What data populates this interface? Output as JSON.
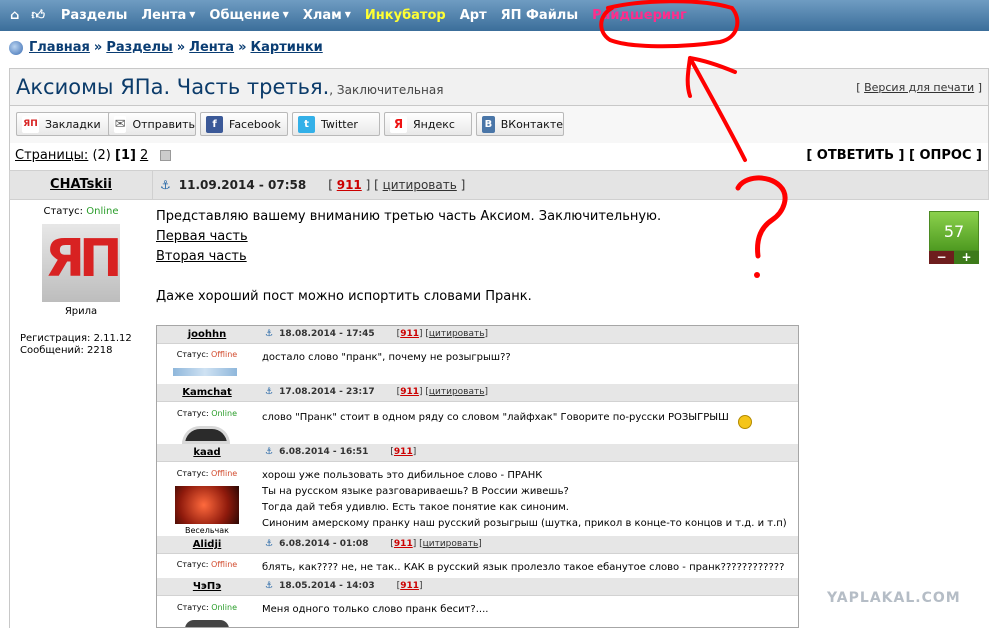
{
  "topnav": {
    "items": [
      {
        "label": "Разделы"
      },
      {
        "label": "Лента"
      },
      {
        "label": "Общение"
      },
      {
        "label": "Хлам"
      },
      {
        "label": "Инкубатор"
      },
      {
        "label": "Арт"
      },
      {
        "label": "ЯП Файлы"
      },
      {
        "label": "Райдшеринг"
      }
    ],
    "caret": "▼"
  },
  "breadcrumb": {
    "items": [
      "Главная",
      "Разделы",
      "Лента",
      "Картинки"
    ],
    "sep": "»"
  },
  "topic": {
    "title": "Аксиомы ЯПа. Часть третья.",
    "subtitle": ", Заключительная",
    "print_open": "[ ",
    "print_label": "Версия для печати",
    "print_close": " ]"
  },
  "share": {
    "buttons": [
      {
        "icon": "ЯП",
        "label": "Закладки"
      },
      {
        "icon": "✉",
        "label": "Отправить"
      },
      {
        "icon": "f",
        "label": "Facebook"
      },
      {
        "icon": "t",
        "label": "Twitter"
      },
      {
        "icon": "Я",
        "label": "Яндекс"
      },
      {
        "icon": "B",
        "label": "ВКонтакте"
      }
    ]
  },
  "pages": {
    "label": "Страницы:",
    "count": " (2) ",
    "current": "[1]",
    "next": "2",
    "actions": "[ ОТВЕТИТЬ ] [ ОПРОС ]"
  },
  "post": {
    "author": "CHATskii",
    "date": "11.09.2014 - 07:58",
    "num": "911",
    "cite": "цитировать",
    "br_open": "[ ",
    "br_mid": " ] [ ",
    "br_close": " ]",
    "status_label": "Статус: ",
    "status": "Online",
    "avatar_text": "ЯП",
    "avatar_caption": "Ярила",
    "reg_label": "Регистрация: 2.11.12",
    "msgs_label": "Сообщений: 2218",
    "rating": "57",
    "rating_minus": "−",
    "rating_plus": "+",
    "lines": {
      "intro": "Представляю вашему вниманию третью часть Аксиом. Заключительную.",
      "link1": "Первая часть",
      "link2": "Вторая часть",
      "quote": "Даже хороший пост можно испортить словами Пранк."
    }
  },
  "screenshot": {
    "status_label": "Статус: ",
    "cite": "цитировать",
    "posts": [
      {
        "name": "joohhn",
        "date": "18.08.2014 - 17:45",
        "num": "911",
        "status": "Offline",
        "lines": [
          "достало слово \"пранк\", почему не розыгрыш??"
        ]
      },
      {
        "name": "Kamchat",
        "date": "17.08.2014 - 23:17",
        "num": "911",
        "status": "Online",
        "lines": [
          "слово \"Пранк\" стоит в одном ряду со словом \"лайфхак\" Говорите по-русски РОЗЫГРЫШ"
        ]
      },
      {
        "name": "kaad",
        "date": "6.08.2014 - 16:51",
        "num": "911",
        "status": "Offline",
        "caption": "Весельчак",
        "lines": [
          "хорош уже пользовать это дибильное слово - ПРАНК",
          "Ты на русском языке разговариваешь? В России живешь?",
          "Тогда дай тебя удивлю. Есть такое понятие как синоним.",
          "Синоним амерскому пранку наш русский розыгрыш (шутка, прикол в конце-то концов и т.д. и т.п)"
        ]
      },
      {
        "name": "Alidji",
        "date": "6.08.2014 - 01:08",
        "num": "911",
        "status": "Offline",
        "lines": [
          "блять, как???? не, не так.. КАК в русский язык пролезло такое ебанутое слово - пранк????????????"
        ]
      },
      {
        "name": "ЧэПэ",
        "date": "18.05.2014 - 14:03",
        "num": "911",
        "status": "Online",
        "lines": [
          "Меня одного только слово пранк бесит?...."
        ]
      }
    ]
  },
  "watermark": "YAPLAKAL.COM",
  "colors": {
    "nav_bg": "#4d80ad",
    "nav_yellow": "#ffff33",
    "nav_pink": "#ff2d8c",
    "link_blue": "#0a3d73",
    "title_blue": "#0b3b6a",
    "num_red": "#cc0000",
    "online_green": "#2a9d2a",
    "offline_orange": "#d24c2f",
    "rating_green": "#6db936",
    "annotation_red": "#ff0000"
  }
}
